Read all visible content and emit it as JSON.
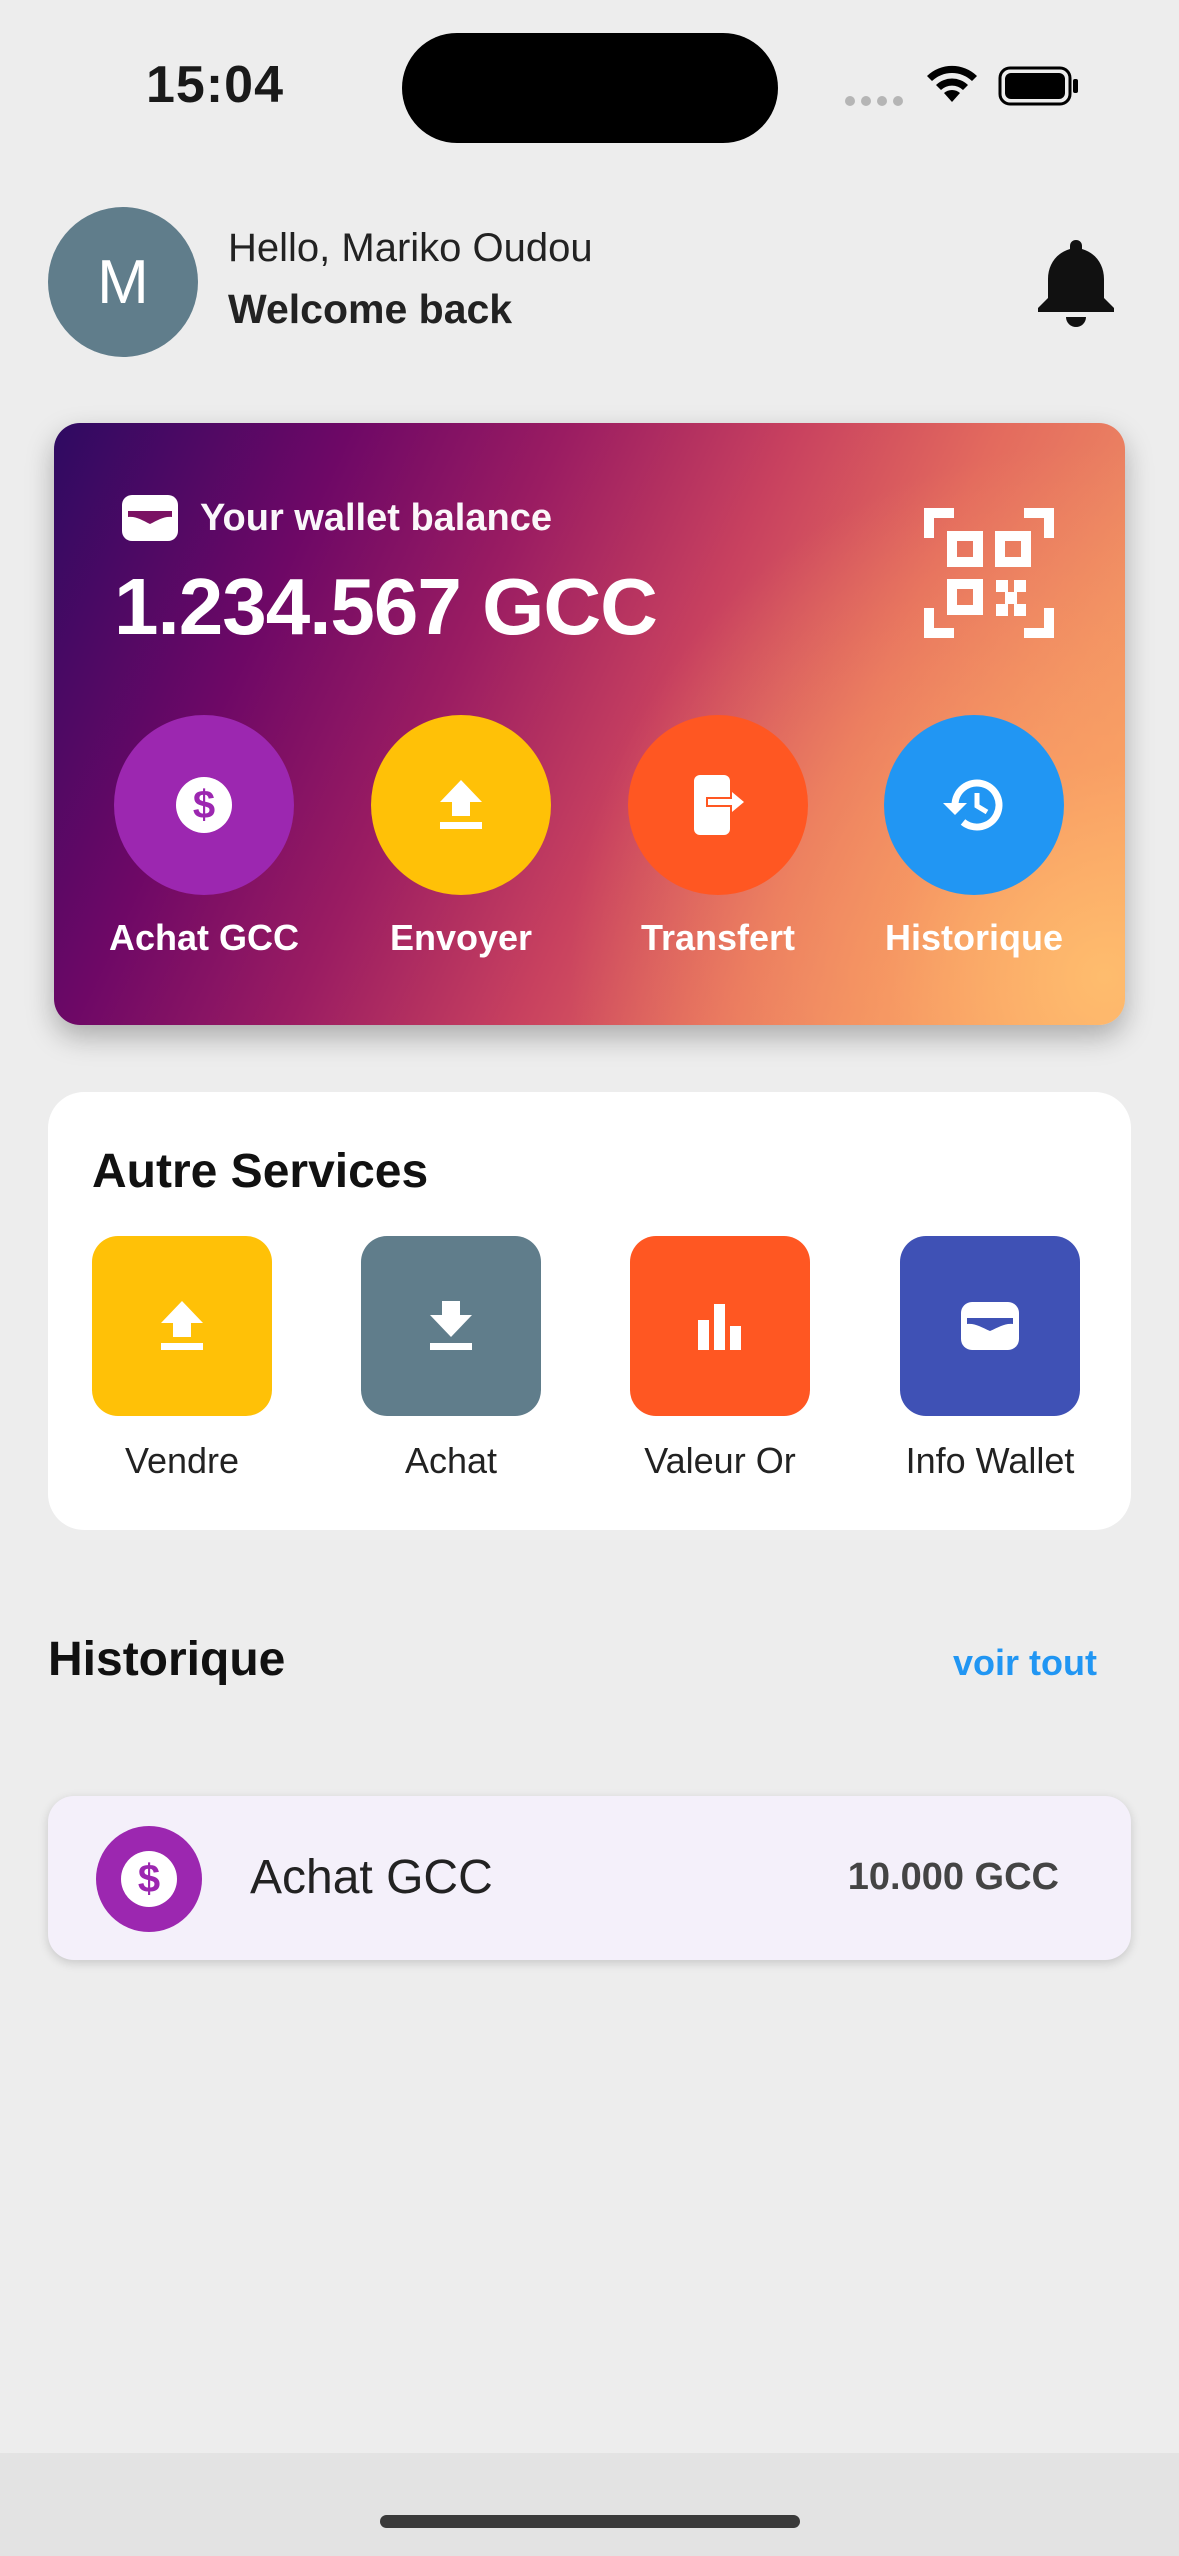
{
  "status_bar": {
    "time": "15:04"
  },
  "header": {
    "avatar_initial": "M",
    "greeting": "Hello, Mariko Oudou",
    "welcome": "Welcome back"
  },
  "wallet": {
    "label": "Your wallet balance",
    "amount": "1.234.567 GCC",
    "actions": [
      {
        "label": "Achat GCC",
        "icon": "dollar-icon",
        "color": "#9C27B0"
      },
      {
        "label": "Envoyer",
        "icon": "upload-icon",
        "color": "#FFC107"
      },
      {
        "label": "Transfert",
        "icon": "phone-exit-icon",
        "color": "#FF5722"
      },
      {
        "label": "Historique",
        "icon": "history-icon",
        "color": "#2196F3"
      }
    ]
  },
  "services": {
    "title": "Autre Services",
    "items": [
      {
        "label": "Vendre",
        "icon": "upload-icon",
        "color": "#FFC107"
      },
      {
        "label": "Achat",
        "icon": "download-icon",
        "color": "#607D8B"
      },
      {
        "label": "Valeur Or",
        "icon": "bar-chart-icon",
        "color": "#FF5722"
      },
      {
        "label": "Info Wallet",
        "icon": "wallet-icon",
        "color": "#3F51B5"
      }
    ]
  },
  "history": {
    "title": "Historique",
    "see_all": "voir tout",
    "items": [
      {
        "label": "Achat GCC",
        "amount": "10.000 GCC",
        "icon": "dollar-icon",
        "color": "#9C27B0"
      }
    ]
  }
}
